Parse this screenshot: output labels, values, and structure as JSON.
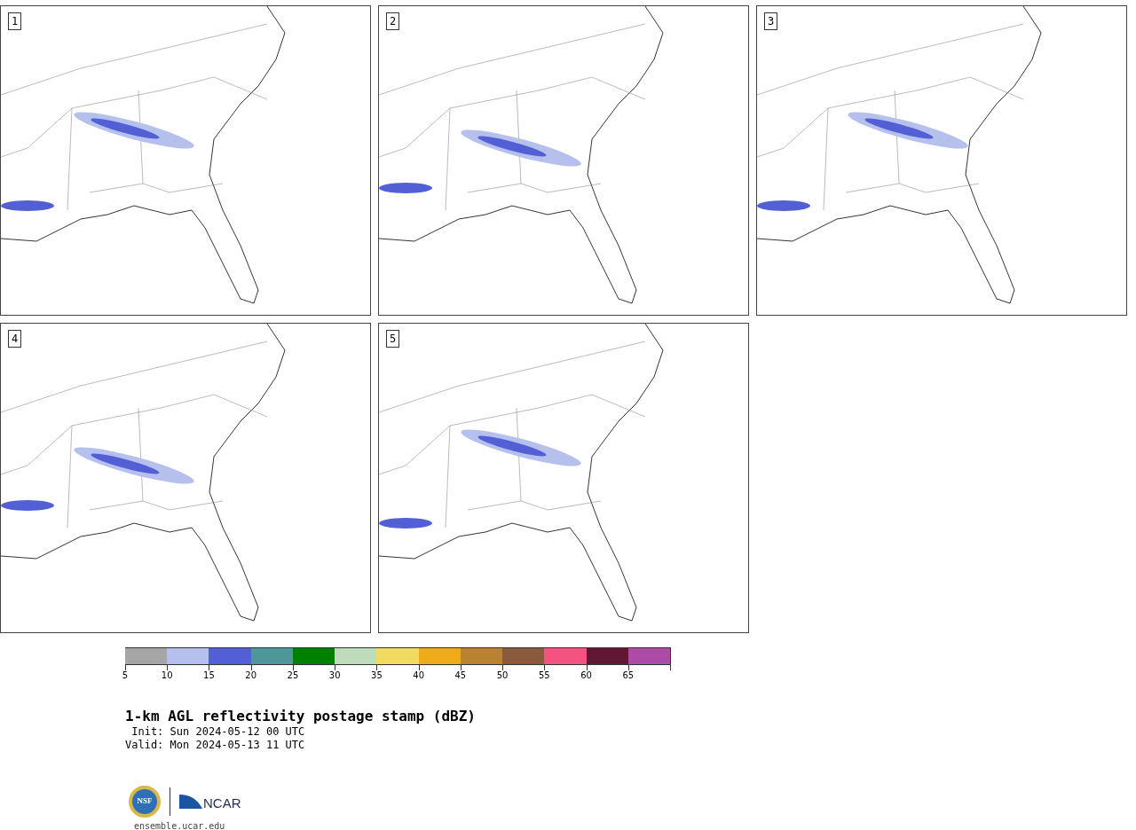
{
  "panels": [
    {
      "label": "1"
    },
    {
      "label": "2"
    },
    {
      "label": "3"
    },
    {
      "label": "4"
    },
    {
      "label": "5"
    }
  ],
  "colorbar": {
    "segments": [
      {
        "color": "#a6a6a6"
      },
      {
        "color": "#b6c0ec"
      },
      {
        "color": "#525fd5"
      },
      {
        "color": "#4f9599"
      },
      {
        "color": "#008000"
      },
      {
        "color": "#bedcbc"
      },
      {
        "color": "#f0da60"
      },
      {
        "color": "#efac1a"
      },
      {
        "color": "#b88232"
      },
      {
        "color": "#8a5a3e"
      },
      {
        "color": "#f45280"
      },
      {
        "color": "#5f1734"
      },
      {
        "color": "#ac4ca6"
      }
    ],
    "ticks": [
      "5",
      "10",
      "15",
      "20",
      "25",
      "30",
      "35",
      "40",
      "45",
      "50",
      "55",
      "60",
      "65"
    ]
  },
  "title": "1-km AGL reflectivity postage stamp (dBZ)",
  "init": " Init: Sun 2024-05-12 00 UTC",
  "valid": "Valid: Mon 2024-05-13 11 UTC",
  "logos": {
    "nsf": "NSF",
    "ncar": "NCAR"
  },
  "footer": "ensemble.ucar.edu"
}
